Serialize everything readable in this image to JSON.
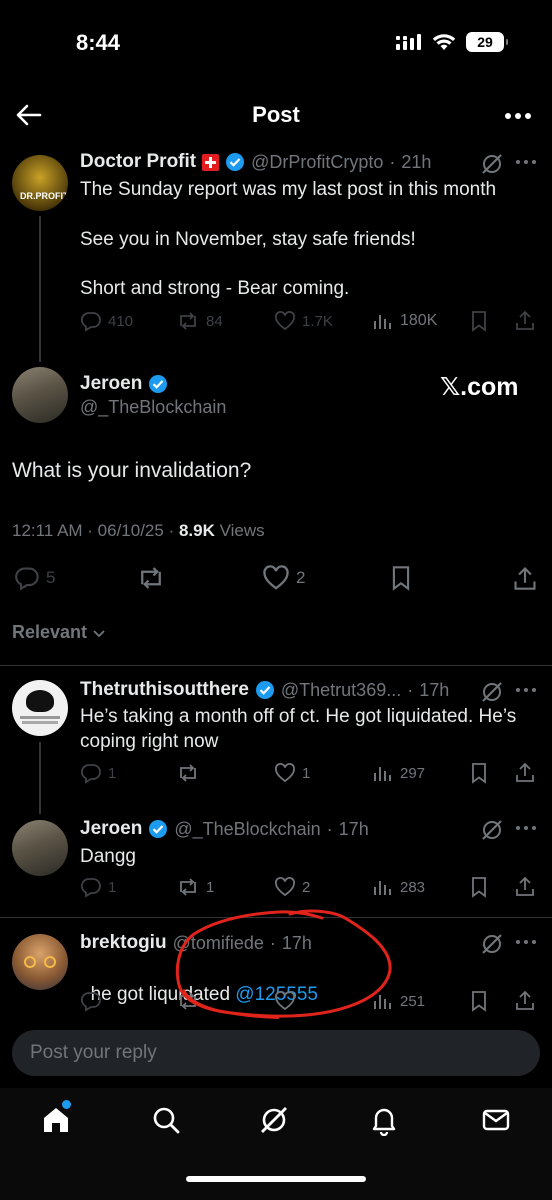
{
  "status": {
    "time": "8:44",
    "battery": "29"
  },
  "header": {
    "title": "Post"
  },
  "parent": {
    "name": "Doctor Profit",
    "handle": "@DrProfitCrypto",
    "time": "21h",
    "lines": [
      "The Sunday report was my last post in this month",
      "See you in November, stay safe friends!",
      "Short and strong - Bear coming."
    ],
    "replies": "410",
    "reposts": "84",
    "likes": "1.7K",
    "views": "180K"
  },
  "main": {
    "name": "Jeroen",
    "handle": "@_TheBlockchain",
    "watermark": "𝕏.com",
    "text": "What is your invalidation?",
    "timestamp": "12:11 AM · 06/10/25 · ",
    "views_count": "8.9K",
    "views_label": " Views",
    "replies": "5",
    "likes": "2"
  },
  "sort": {
    "label": "Relevant"
  },
  "replies": [
    {
      "name": "Thetruthisoutthere",
      "handle": "@Thetrut369... ",
      "time": "17h",
      "text": "He’s taking a month off of ct. He got liquidated. He’s coping right now",
      "replies": "1",
      "reposts": "",
      "likes": "1",
      "views": "297"
    },
    {
      "name": "Jeroen",
      "handle": "@_TheBlockchain",
      "time": "17h",
      "text": "Dangg",
      "replies": "1",
      "reposts": "1",
      "likes": "2",
      "views": "283"
    },
    {
      "name": "brektogiu",
      "handle": "@tomifiede",
      "time": "17h",
      "text": "he got liquidated ",
      "mention": "@125555",
      "replies": "",
      "reposts": "",
      "likes": "",
      "views": "251"
    }
  ],
  "reply_bar": {
    "placeholder": "Post your reply"
  },
  "colors": {
    "accent": "#1d9bf0",
    "annotation": "#e0241b",
    "swiss": "#e41e20"
  }
}
